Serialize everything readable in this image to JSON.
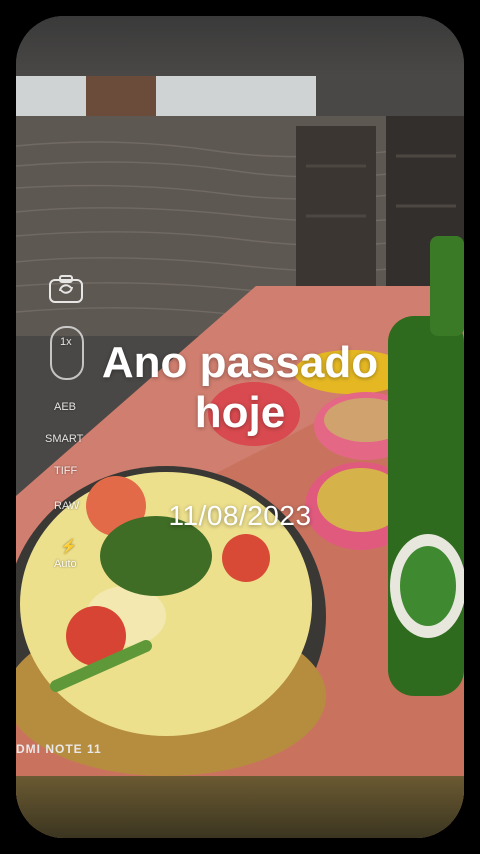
{
  "memory": {
    "title": "Ano passado\nhoje",
    "date": "11/08/2023"
  },
  "camera_ui": {
    "zoom": "1x",
    "mode_aeb": "AEB",
    "mode_smart": "SMART",
    "mode_tiff": "TIFF",
    "mode_raw": "RAW",
    "flash": "Auto",
    "icons": [
      "camera-switch-icon",
      "lens-icon",
      "flash-icon"
    ]
  },
  "watermark": "DMI NOTE 11"
}
